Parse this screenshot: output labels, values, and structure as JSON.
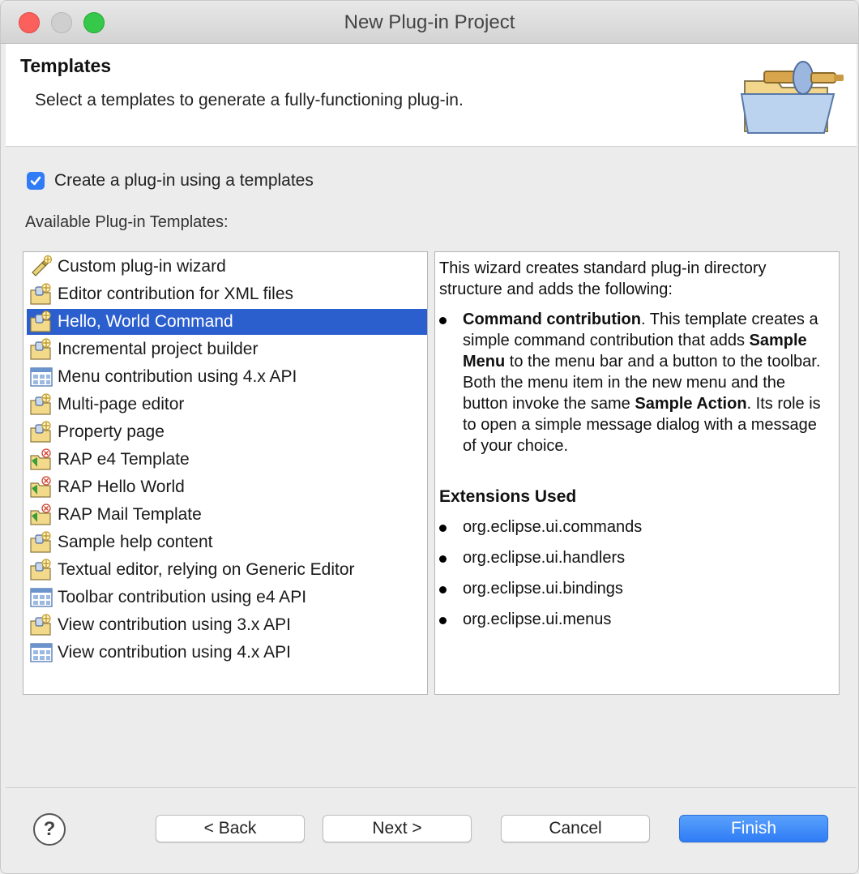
{
  "window": {
    "title": "New Plug-in Project"
  },
  "header": {
    "title": "Templates",
    "description": "Select a templates to generate a fully-functioning plug-in."
  },
  "options": {
    "use_template_label": "Create a plug-in using a templates",
    "use_template_checked": true
  },
  "templates": {
    "label": "Available Plug-in Templates:",
    "items": [
      {
        "label": "Custom plug-in wizard",
        "icon": "wand-icon"
      },
      {
        "label": "Editor contribution for XML files",
        "icon": "plugin-folder-icon"
      },
      {
        "label": "Hello, World Command",
        "icon": "plugin-folder-icon",
        "selected": true
      },
      {
        "label": "Incremental project builder",
        "icon": "plugin-folder-icon"
      },
      {
        "label": "Menu contribution using 4.x API",
        "icon": "grid-window-icon"
      },
      {
        "label": "Multi-page editor",
        "icon": "plugin-folder-icon"
      },
      {
        "label": "Property page",
        "icon": "plugin-folder-icon"
      },
      {
        "label": "RAP e4 Template",
        "icon": "rap-plugin-icon"
      },
      {
        "label": "RAP Hello World",
        "icon": "rap-plugin-icon"
      },
      {
        "label": "RAP Mail Template",
        "icon": "rap-plugin-icon"
      },
      {
        "label": "Sample help content",
        "icon": "plugin-folder-icon"
      },
      {
        "label": "Textual editor, relying on Generic Editor",
        "icon": "plugin-folder-icon"
      },
      {
        "label": "Toolbar contribution using e4 API",
        "icon": "grid-window-icon"
      },
      {
        "label": "View contribution using 3.x API",
        "icon": "plugin-folder-icon"
      },
      {
        "label": "View contribution using 4.x API",
        "icon": "grid-window-icon"
      }
    ]
  },
  "details": {
    "intro": "This wizard creates standard plug-in directory structure and adds the following:",
    "bullet": {
      "bold1": "Command contribution",
      "text1": ". This template creates a simple command contribution that adds ",
      "bold2": "Sample Menu",
      "text2": " to the menu bar and a button to the toolbar. Both the menu item in the new menu and the button invoke the same ",
      "bold3": "Sample Action",
      "text3": ". Its role is to open a simple message dialog with a message of your choice."
    },
    "extensions_title": "Extensions Used",
    "extensions": [
      "org.eclipse.ui.commands",
      "org.eclipse.ui.handlers",
      "org.eclipse.ui.bindings",
      "org.eclipse.ui.menus"
    ]
  },
  "buttons": {
    "help": "?",
    "back": "< Back",
    "next": "Next >",
    "cancel": "Cancel",
    "finish": "Finish"
  },
  "colors": {
    "selection": "#2c5fce",
    "primary_button": "#2f7cf6"
  }
}
